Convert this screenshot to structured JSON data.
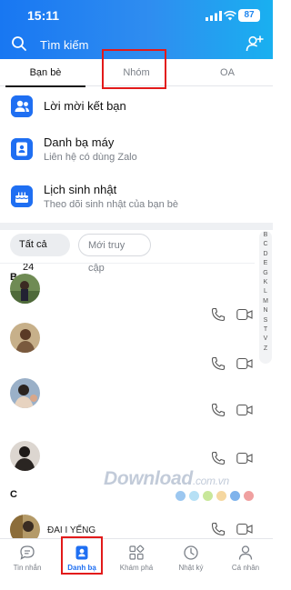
{
  "status_bar": {
    "time": "15:11",
    "battery": "87"
  },
  "search": {
    "placeholder": "Tìm kiếm"
  },
  "tabs": [
    {
      "label": "Bạn bè",
      "active": true
    },
    {
      "label": "Nhóm",
      "active": false
    },
    {
      "label": "OA",
      "active": false
    }
  ],
  "features": [
    {
      "title": "Lời mời kết bạn",
      "subtitle": "",
      "icon": "friend-request-icon"
    },
    {
      "title": "Danh bạ máy",
      "subtitle": "Liên hệ có dùng Zalo",
      "icon": "phonebook-icon"
    },
    {
      "title": "Lịch sinh nhật",
      "subtitle": "Theo dõi sinh nhật của bạn bè",
      "icon": "birthday-cake-icon"
    }
  ],
  "filters": {
    "all_label": "Tất cả",
    "all_count": "24",
    "recent_label": "Mới truy cập"
  },
  "sections": {
    "b": "B",
    "c": "C"
  },
  "alphabet": [
    "B",
    "C",
    "D",
    "E",
    "G",
    "K",
    "L",
    "M",
    "N",
    "S",
    "T",
    "V",
    "Z"
  ],
  "watermark": {
    "brand": "Download",
    "suffix": ".com.vn"
  },
  "partial_name": "ĐAI I YẾNG",
  "nav": [
    {
      "label": "Tin nhắn",
      "icon": "chat-bubble-icon",
      "active": false
    },
    {
      "label": "Danh bạ",
      "icon": "contacts-icon",
      "active": true
    },
    {
      "label": "Khám phá",
      "icon": "grid-icon",
      "active": false
    },
    {
      "label": "Nhật ký",
      "icon": "clock-icon",
      "active": false
    },
    {
      "label": "Cá nhân",
      "icon": "person-icon",
      "active": false
    }
  ],
  "colors": {
    "brand": "#1f6ff2",
    "highlight": "#e21a1a"
  }
}
